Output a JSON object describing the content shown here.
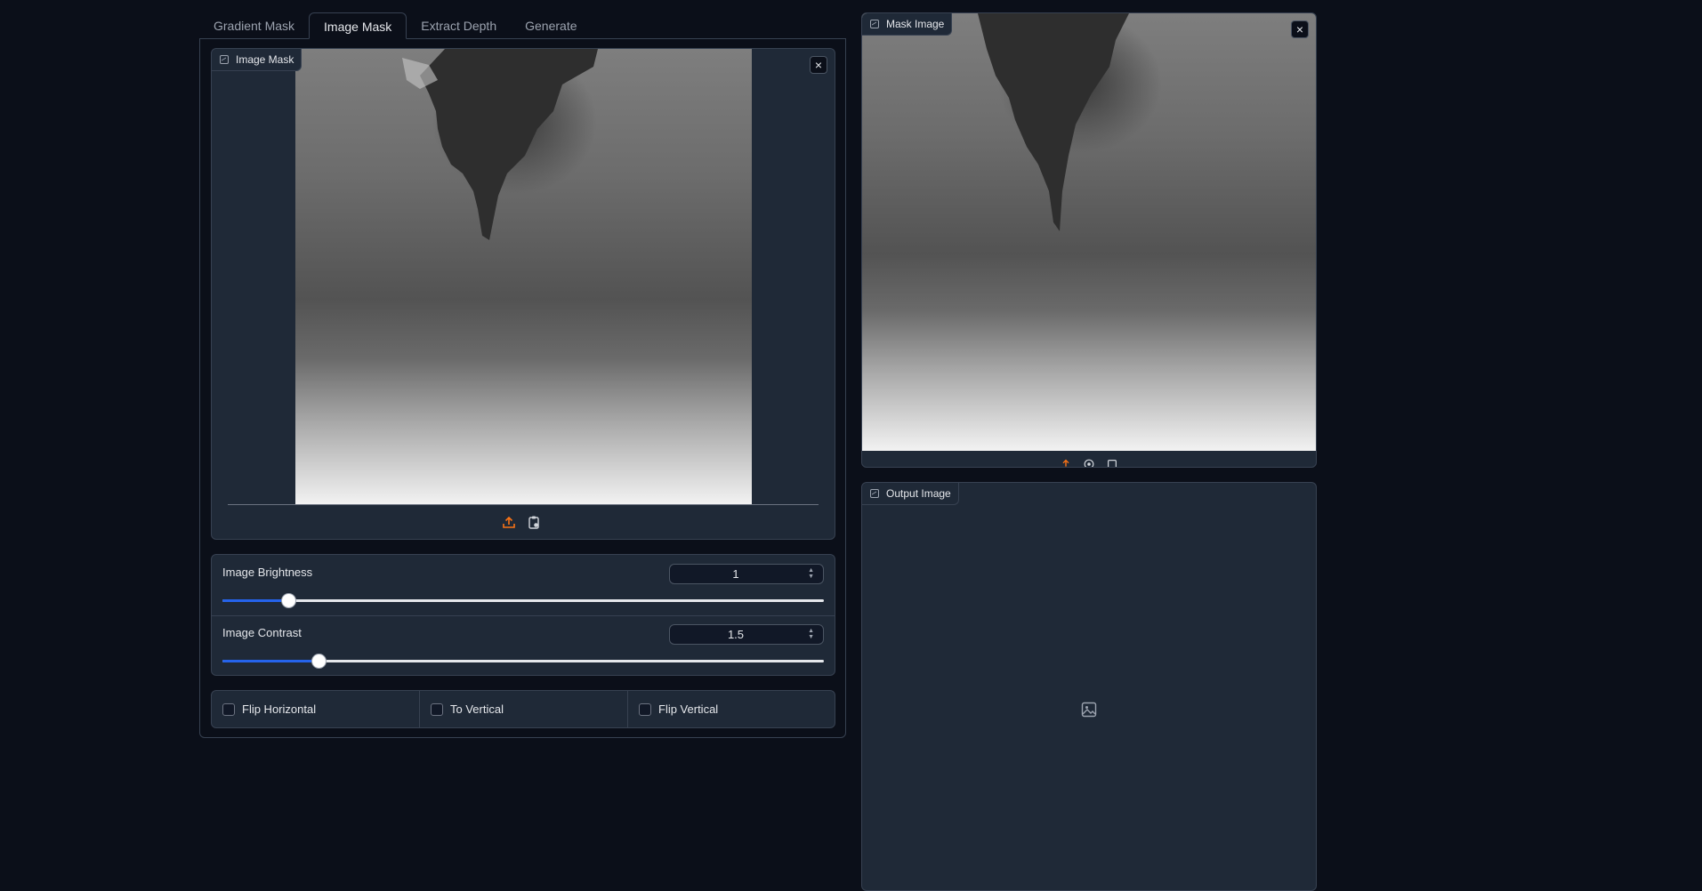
{
  "tabs": [
    {
      "label": "Gradient Mask",
      "active": false
    },
    {
      "label": "Image Mask",
      "active": true
    },
    {
      "label": "Extract Depth",
      "active": false
    },
    {
      "label": "Generate",
      "active": false
    }
  ],
  "image_mask": {
    "label": "Image Mask",
    "icons": [
      "image-icon",
      "close-icon",
      "upload-icon",
      "clipboard-icon"
    ]
  },
  "sliders": [
    {
      "label": "Image Brightness",
      "value": "1",
      "fraction": 0.11
    },
    {
      "label": "Image Contrast",
      "value": "1.5",
      "fraction": 0.16
    }
  ],
  "checkboxes": [
    {
      "label": "Flip Horizontal",
      "checked": false
    },
    {
      "label": "To Vertical",
      "checked": false
    },
    {
      "label": "Flip Vertical",
      "checked": false
    }
  ],
  "mask_image": {
    "label": "Mask Image",
    "icons": [
      "image-icon",
      "close-icon",
      "upload-icon",
      "webcam-icon",
      "clipboard-icon"
    ]
  },
  "output_image": {
    "label": "Output Image",
    "icons": [
      "image-icon",
      "image-placeholder-icon"
    ]
  },
  "colors": {
    "background": "#0b0f19",
    "panel": "#1f2937",
    "border": "#374151",
    "accent": "#2563eb",
    "upload_orange": "#f97316"
  }
}
